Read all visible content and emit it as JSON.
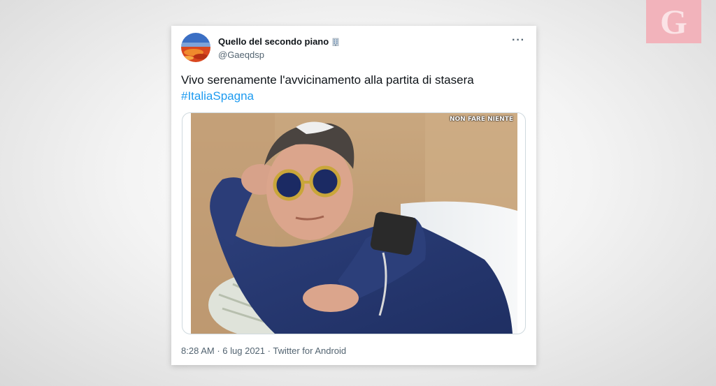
{
  "tweet": {
    "display_name": "Quello del secondo piano",
    "handle": "@Gaeqdsp",
    "more_label": "···",
    "text": "Vivo serenamente l'avvicinamento alla partita di stasera",
    "hashtag": "#ItaliaSpagna",
    "media_caption": "NON FARE NIENTE",
    "time": "8:28 AM",
    "separator": "·",
    "date": "6 lug 2021",
    "source": "Twitter for Android"
  },
  "channel_logo": {
    "letter": "G",
    "color": "#f2b3bb"
  },
  "icons": {
    "building": "office-building-icon",
    "more": "more-dots-icon"
  },
  "colors": {
    "hashtag": "#1d9bf0",
    "text": "#0f1419",
    "muted": "#536471"
  }
}
